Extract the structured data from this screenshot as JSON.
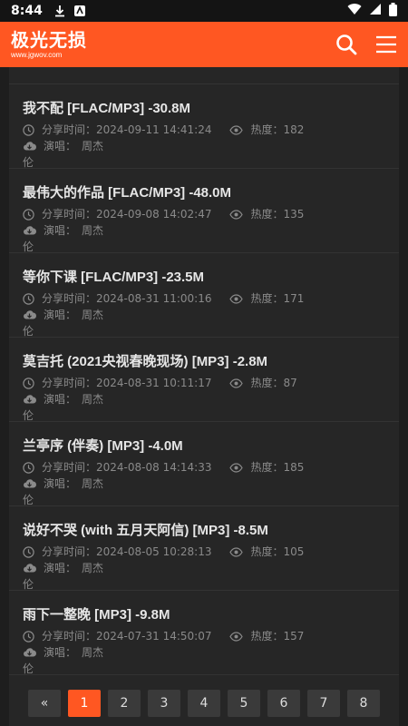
{
  "status_bar": {
    "time": "8:44"
  },
  "header": {
    "logo_title": "极光无损",
    "logo_url": "www.jgwov.com",
    "brand_color": "#ff5722"
  },
  "meta_labels": {
    "share_time": "分享时间：",
    "heat": "热度：",
    "singer": "演唱："
  },
  "songs": [
    {
      "title": "我不配 [FLAC/MP3] -30.8M",
      "time": "2024-09-11 14:41:24",
      "heat": "182",
      "singer_a": "周杰",
      "singer_b": "伦"
    },
    {
      "title": "最伟大的作品 [FLAC/MP3] -48.0M",
      "time": "2024-09-08 14:02:47",
      "heat": "135",
      "singer_a": "周杰",
      "singer_b": "伦"
    },
    {
      "title": "等你下课 [FLAC/MP3] -23.5M",
      "time": "2024-08-31 11:00:16",
      "heat": "171",
      "singer_a": "周杰",
      "singer_b": "伦"
    },
    {
      "title": "莫吉托 (2021央视春晚现场) [MP3] -2.8M",
      "time": "2024-08-31 10:11:17",
      "heat": "87",
      "singer_a": "周杰",
      "singer_b": "伦"
    },
    {
      "title": "兰亭序 (伴奏) [MP3] -4.0M",
      "time": "2024-08-08 14:14:33",
      "heat": "185",
      "singer_a": "周杰",
      "singer_b": "伦"
    },
    {
      "title": "说好不哭 (with 五月天阿信) [MP3] -8.5M",
      "time": "2024-08-05 10:28:13",
      "heat": "105",
      "singer_a": "周杰",
      "singer_b": "伦"
    },
    {
      "title": "雨下一整晚 [MP3] -9.8M",
      "time": "2024-07-31 14:50:07",
      "heat": "157",
      "singer_a": "周杰",
      "singer_b": "伦"
    }
  ],
  "pagination": {
    "prev": "«",
    "pages": [
      "1",
      "2",
      "3",
      "4",
      "5",
      "6",
      "7",
      "8"
    ],
    "active": "1"
  }
}
